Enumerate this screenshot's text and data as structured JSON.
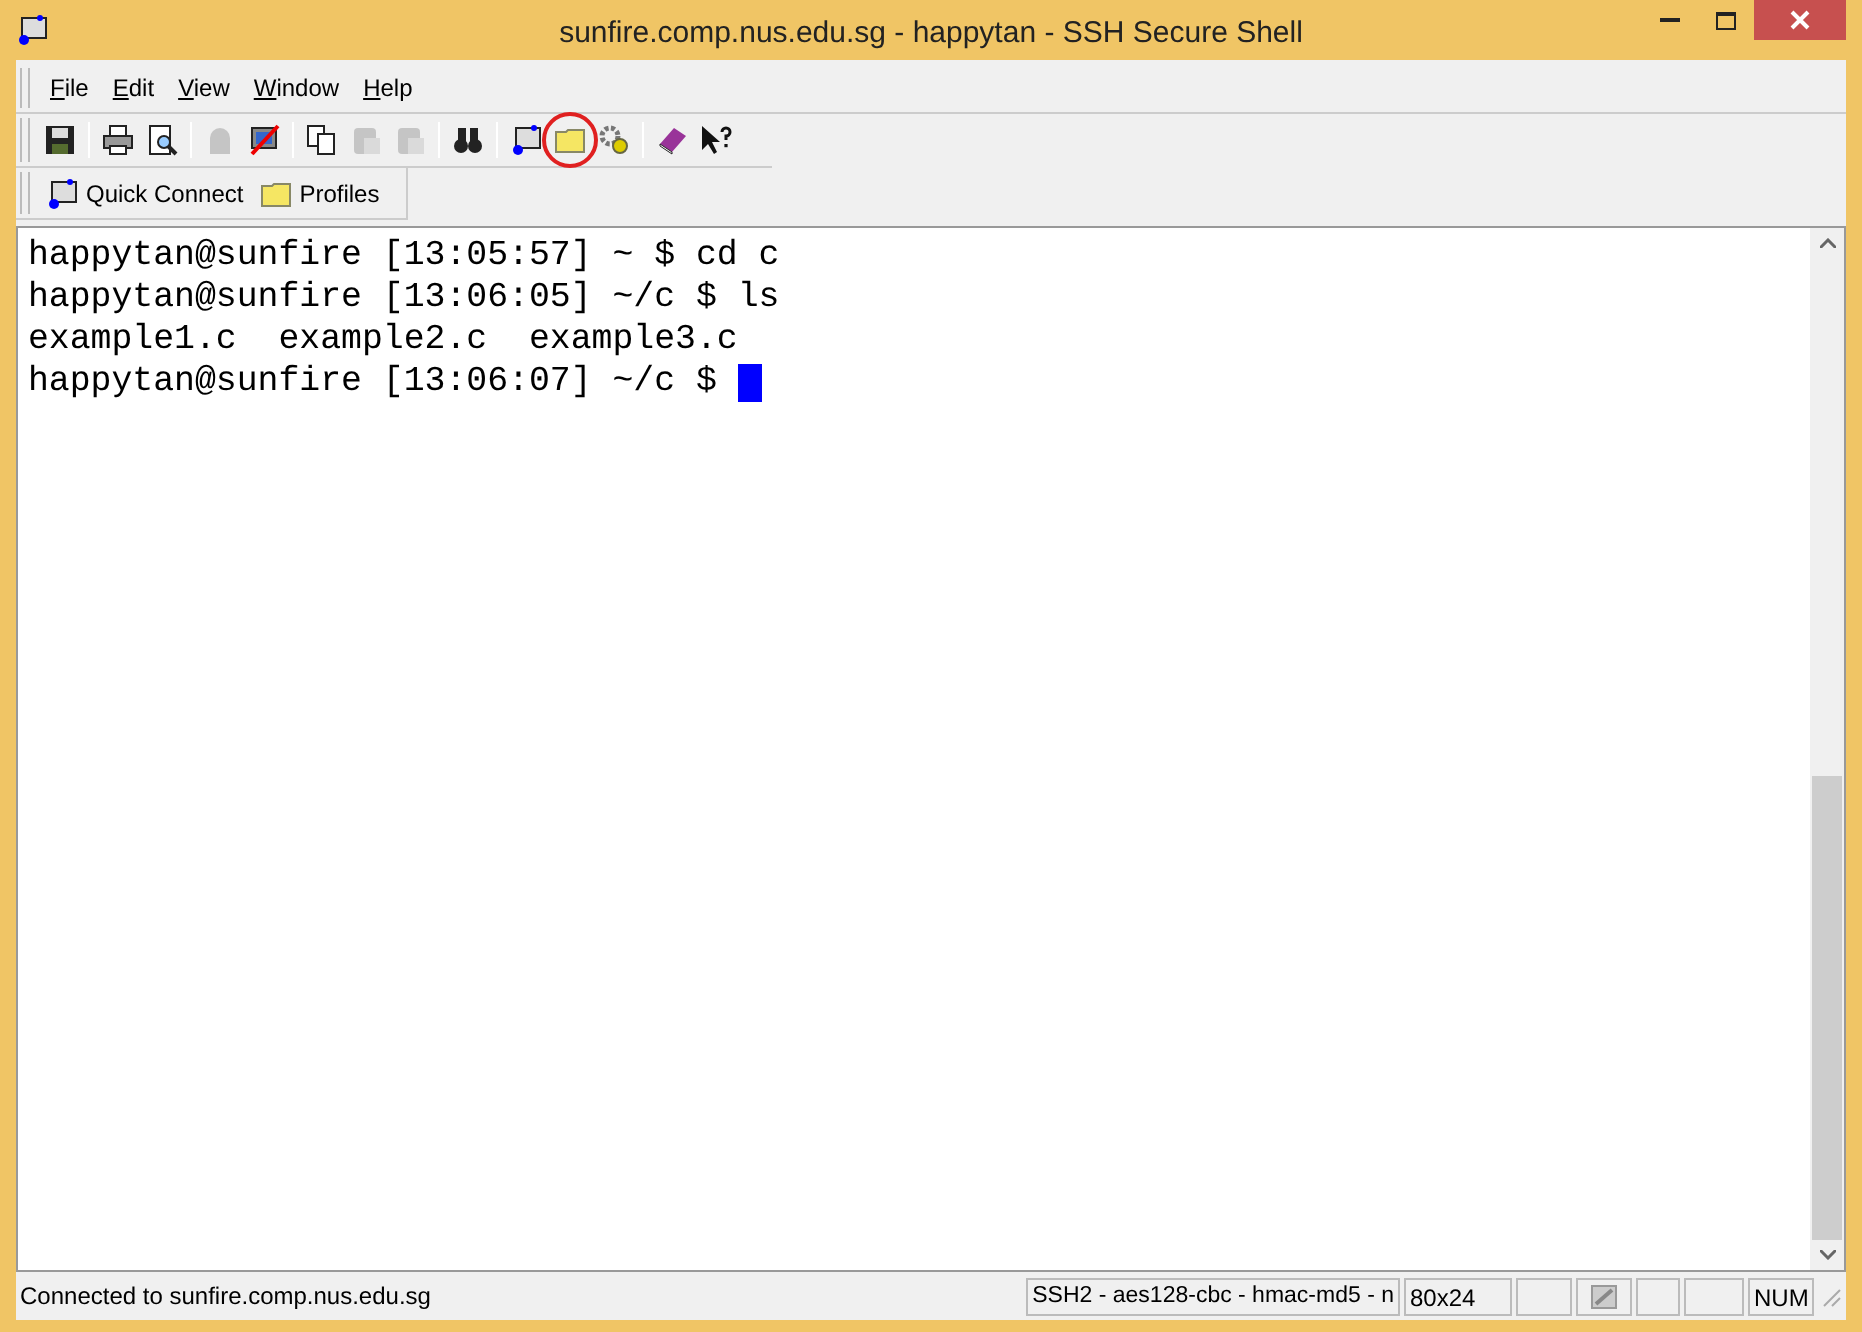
{
  "window": {
    "title": "sunfire.comp.nus.edu.sg - happytan - SSH Secure Shell"
  },
  "menu": [
    "File",
    "Edit",
    "View",
    "Window",
    "Help"
  ],
  "toolbar": [
    [
      {
        "kind": "save",
        "disabled": false,
        "highlighted": false
      }
    ],
    [
      {
        "kind": "print",
        "disabled": false,
        "highlighted": false
      },
      {
        "kind": "preview",
        "disabled": false,
        "highlighted": false
      }
    ],
    [
      {
        "kind": "connect",
        "disabled": true,
        "highlighted": false
      },
      {
        "kind": "disconnect",
        "disabled": false,
        "highlighted": false
      }
    ],
    [
      {
        "kind": "copy",
        "disabled": false,
        "highlighted": false
      },
      {
        "kind": "paste",
        "disabled": true,
        "highlighted": false
      },
      {
        "kind": "paste",
        "disabled": true,
        "highlighted": false
      }
    ],
    [
      {
        "kind": "find",
        "disabled": false,
        "highlighted": false
      }
    ],
    [
      {
        "kind": "terminal",
        "disabled": false,
        "highlighted": false
      },
      {
        "kind": "folder",
        "disabled": false,
        "highlighted": true
      },
      {
        "kind": "gear",
        "disabled": false,
        "highlighted": false
      }
    ],
    [
      {
        "kind": "book",
        "disabled": false,
        "highlighted": false
      },
      {
        "kind": "whatsthis",
        "disabled": false,
        "highlighted": false
      }
    ]
  ],
  "shortcuts": [
    {
      "kind": "terminal",
      "label": "Quick Connect"
    },
    {
      "kind": "folder",
      "label": "Profiles"
    }
  ],
  "terminal": {
    "lines": [
      "happytan@sunfire [13:05:57] ~ $ cd c",
      "happytan@sunfire [13:06:05] ~/c $ ls",
      "example1.c  example2.c  example3.c",
      "happytan@sunfire [13:06:07] ~/c $ "
    ]
  },
  "status_bar": {
    "message": "Connected to sunfire.comp.nus.edu.sg",
    "cipher": "SSH2 - aes128-cbc - hmac-md5 - n",
    "size": "80x24",
    "num": "NUM"
  }
}
